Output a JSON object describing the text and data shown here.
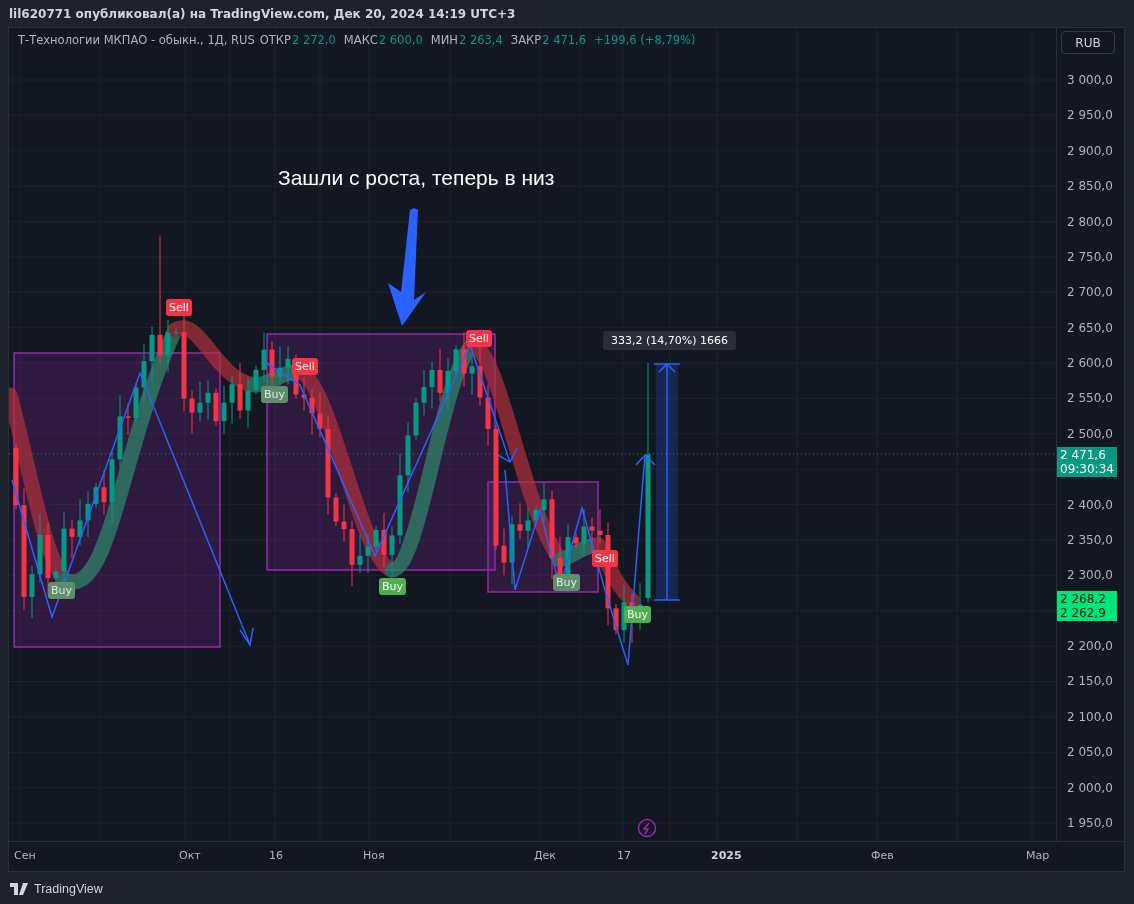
{
  "header": {
    "text": "lil620771 опубликовал(а) на TradingView.com, Дек 20, 2024 14:19 UTC+3"
  },
  "legend": {
    "symbol": "Т-Технологии МКПАО - обыкн., 1Д, RUS",
    "ohlc": [
      {
        "label": "ОТКР",
        "value": "2 272,0"
      },
      {
        "label": "МАКС",
        "value": "2 600,0"
      },
      {
        "label": "МИН",
        "value": "2 263,4"
      },
      {
        "label": "ЗАКР",
        "value": "2 471,6"
      }
    ],
    "change": "+199,6 (+8,79%)"
  },
  "currency_button": "RUB",
  "y_axis": {
    "labels": [
      "3 000,0",
      "2 950,0",
      "2 900,0",
      "2 850,0",
      "2 800,0",
      "2 750,0",
      "2 700,0",
      "2 650,0",
      "2 600,0",
      "2 550,0",
      "2 500,0",
      "2 400,0",
      "2 350,0",
      "2 300,0",
      "2 200,0",
      "2 150,0",
      "2 100,0",
      "2 050,0",
      "2 000,0",
      "1 950,0"
    ]
  },
  "price_tags": [
    {
      "kind": "last",
      "lines": [
        "2 471,6",
        "09:30:34"
      ]
    },
    {
      "kind": "quote",
      "lines": [
        "2 268,2",
        "2 262,9"
      ]
    }
  ],
  "x_axis": {
    "labels": [
      {
        "text": "Сен",
        "bold": false
      },
      {
        "text": "Окт",
        "bold": false
      },
      {
        "text": "16",
        "bold": false
      },
      {
        "text": "Ноя",
        "bold": false
      },
      {
        "text": "Дек",
        "bold": false
      },
      {
        "text": "17",
        "bold": false
      },
      {
        "text": "2025",
        "bold": true
      },
      {
        "text": "Фев",
        "bold": false
      },
      {
        "text": "Мар",
        "bold": false
      }
    ]
  },
  "annotation": "Зашли с роста, теперь в низ",
  "signals": [
    {
      "label": "Buy",
      "kind": "buy",
      "faded": true
    },
    {
      "label": "Sell",
      "kind": "sell",
      "faded": false
    },
    {
      "label": "Buy",
      "kind": "buy",
      "faded": true
    },
    {
      "label": "Sell",
      "kind": "sell",
      "faded": false
    },
    {
      "label": "Buy",
      "kind": "buy",
      "faded": false
    },
    {
      "label": "Sell",
      "kind": "sell",
      "faded": false
    },
    {
      "label": "Buy",
      "kind": "buy",
      "faded": true
    },
    {
      "label": "Sell",
      "kind": "sell",
      "faded": false
    },
    {
      "label": "Buy",
      "kind": "buy",
      "faded": false
    }
  ],
  "measure": {
    "label": "333,2 (14,70%) 1666"
  },
  "footer": {
    "brand": "TradingView"
  }
}
